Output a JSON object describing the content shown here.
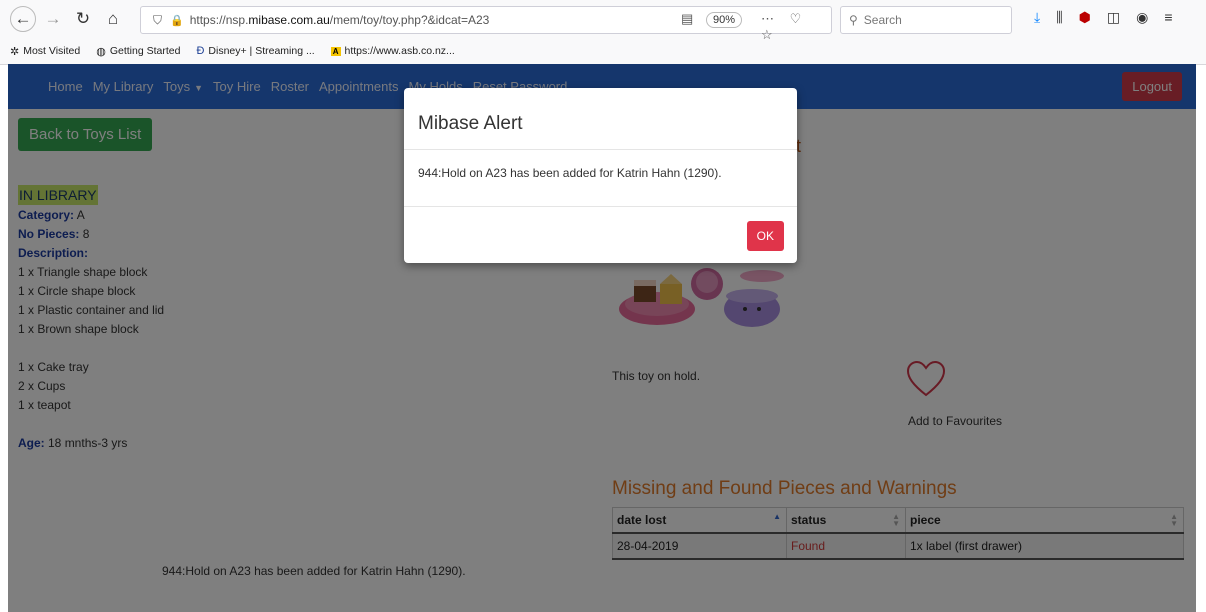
{
  "browser": {
    "url_prefix": "https://nsp.",
    "url_domain": "mibase.com.au",
    "url_path": "/mem/toy/toy.php?&idcat=A23",
    "zoom": "90%",
    "search_placeholder": "Search",
    "bookmarks": [
      {
        "label": "Most Visited",
        "icon": "gear-icon"
      },
      {
        "label": "Getting Started",
        "icon": "globe-icon"
      },
      {
        "label": "Disney+ | Streaming ...",
        "icon": "disney-icon"
      },
      {
        "label": "https://www.asb.co.nz...",
        "icon": "asb-icon"
      }
    ]
  },
  "nav": {
    "items": [
      "Home",
      "My Library",
      "Toys",
      "Toy Hire",
      "Roster",
      "Appointments",
      "My Holds",
      "Reset Password"
    ],
    "logout": "Logout"
  },
  "page": {
    "back_button": "Back to Toys List",
    "status": "IN LIBRARY",
    "category_label": "Category:",
    "category_value": " A",
    "pieces_label": "No Pieces:",
    "pieces_value": " 8",
    "description_label": "Description:",
    "description_lines_1": [
      "1 x Triangle shape block",
      "1 x Circle shape block",
      "1 x Plastic container and lid",
      "1 x Brown shape block"
    ],
    "description_lines_2": [
      "1 x Cake tray",
      "2 x Cups",
      "1 x teapot"
    ],
    "age_label": "Age:",
    "age_value": " 18 mnths-3 yrs",
    "toy_title_fragment": "t",
    "hold_text": "This toy on hold.",
    "favourites": "Add to Favourites",
    "missing_title": "Missing and Found Pieces and Warnings",
    "table_headers": [
      "date lost",
      "status",
      "piece"
    ],
    "table_rows": [
      [
        "28-04-2019",
        "Found",
        "1x label (first drawer)"
      ]
    ],
    "bottom_message": "944:Hold on A23 has been added for Katrin Hahn (1290)."
  },
  "modal": {
    "title": "Mibase Alert",
    "message": "944:Hold on A23 has been added for Katrin Hahn (1290).",
    "ok": "OK"
  },
  "colors": {
    "navbar": "#2b6cd8",
    "logout": "#d13a4a",
    "back_button": "#35a853",
    "status_highlight": "#c9e96a",
    "heading_orange": "#e07b2a",
    "ok_button": "#e0344a"
  }
}
